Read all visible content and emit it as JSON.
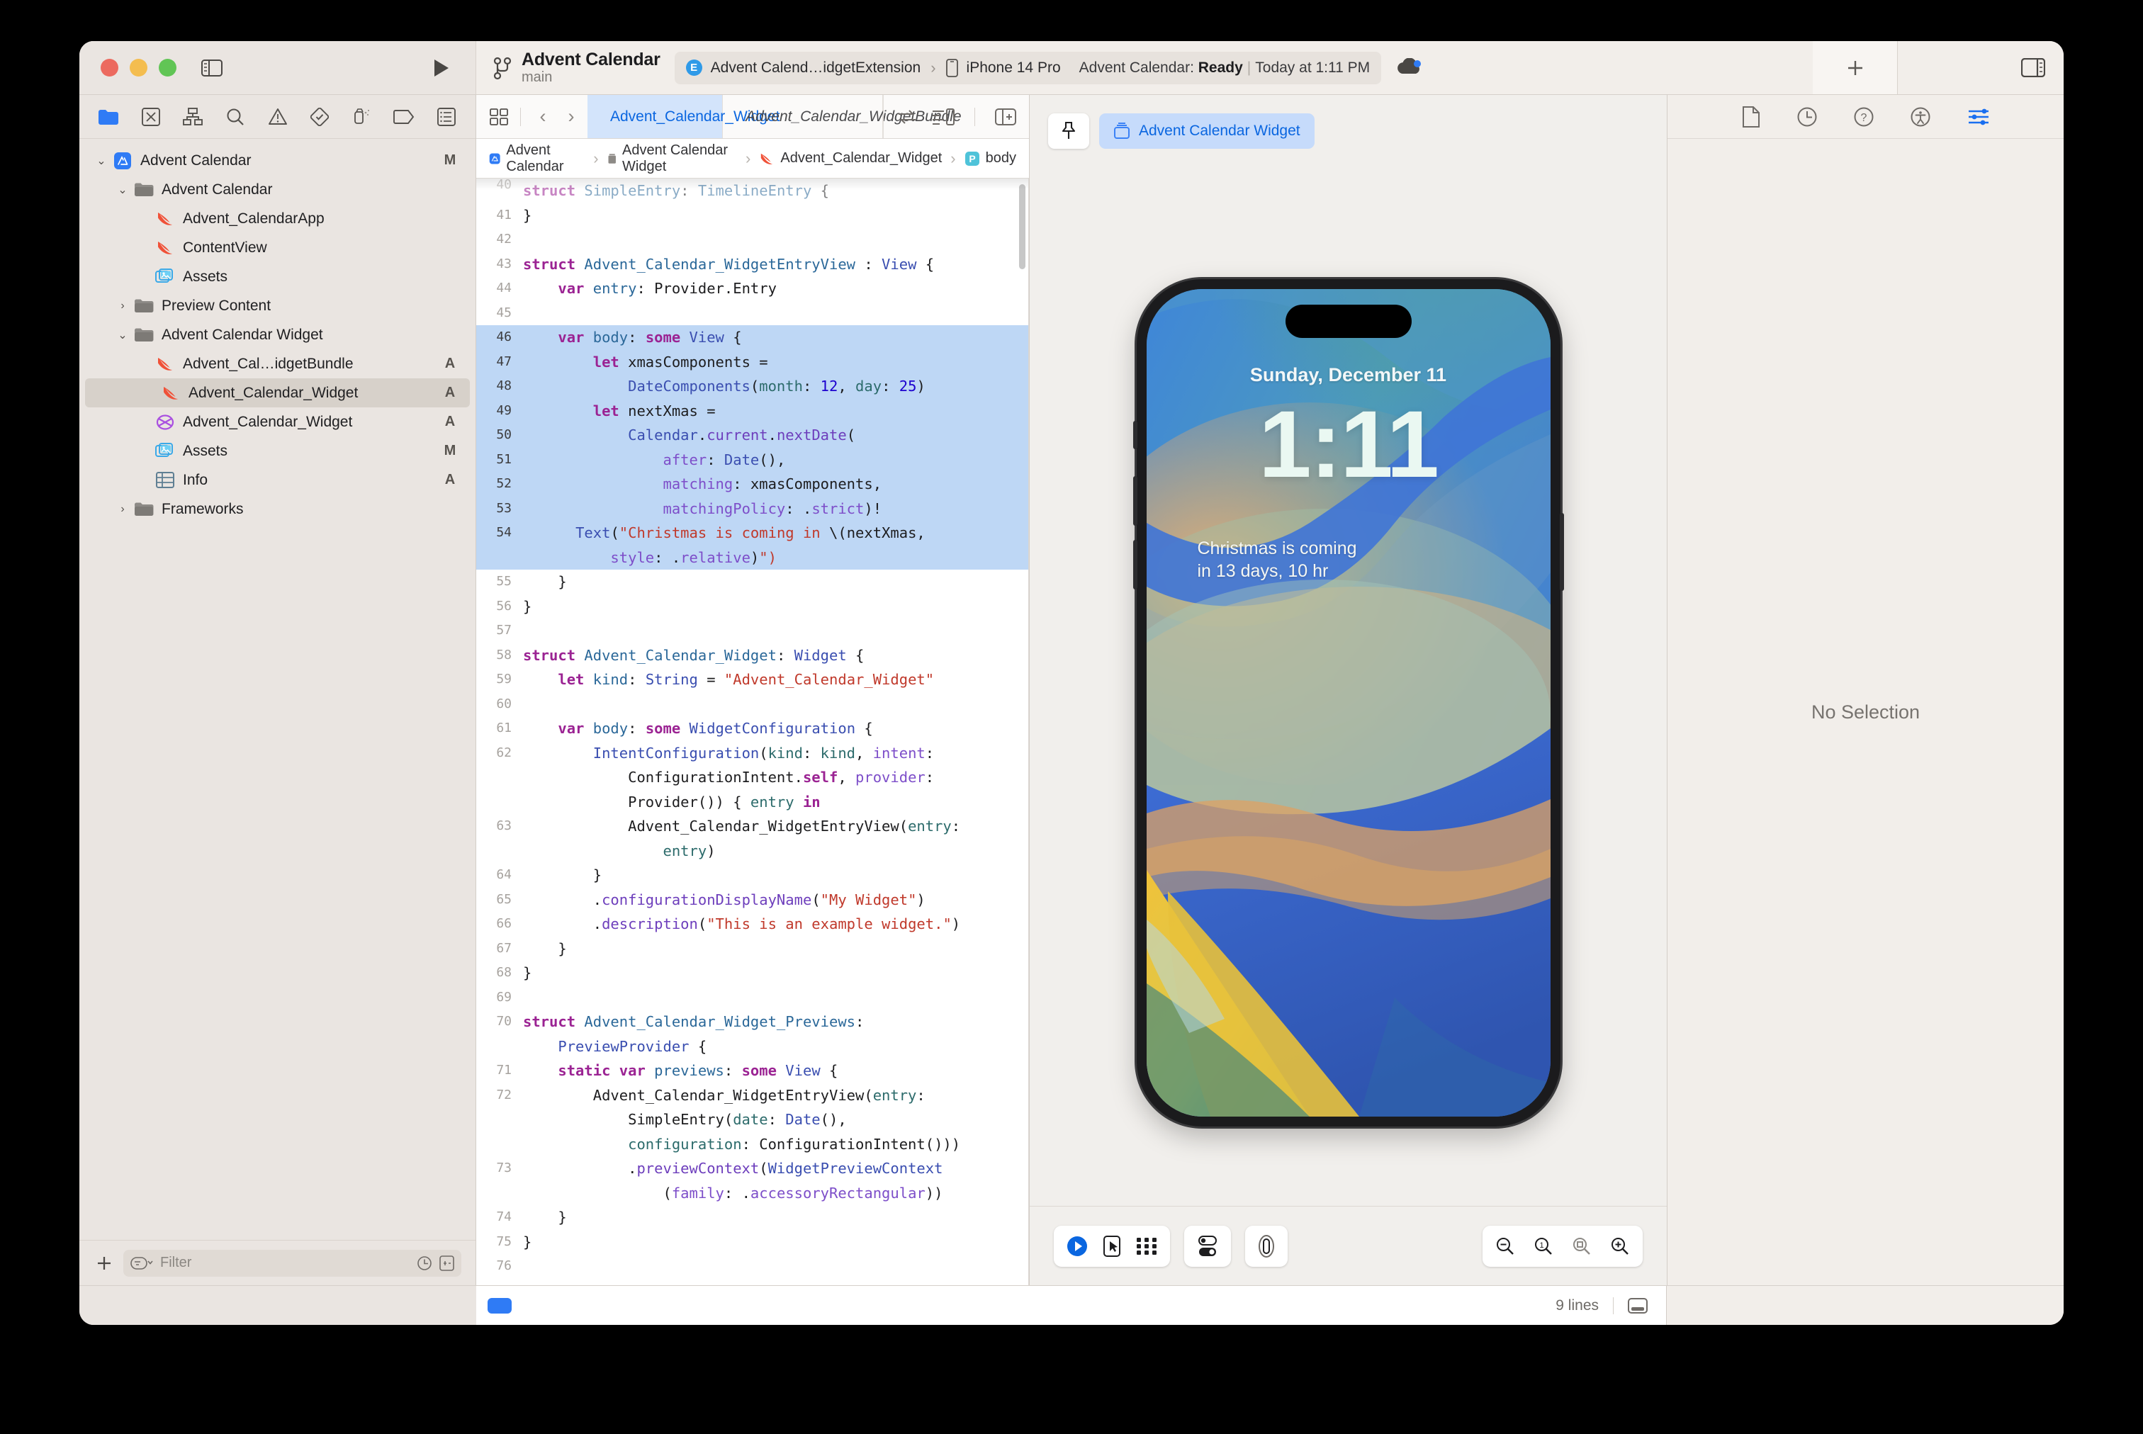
{
  "window": {
    "traffic_lights": [
      "close",
      "minimize",
      "zoom"
    ],
    "scheme": {
      "name": "Advent Calendar",
      "branch": "main",
      "target_badge": "E",
      "target": "Advent Calend…idgetExtension",
      "device": "iPhone 14 Pro",
      "status_prefix": "Advent Calendar:",
      "status_state": "Ready",
      "status_separator": "|",
      "status_time": "Today at 1:11 PM"
    }
  },
  "navigator": {
    "tabs": [
      "folder-icon",
      "source-control-icon",
      "symbol-icon",
      "find-icon",
      "issue-icon",
      "test-icon",
      "debug-icon",
      "breakpoint-icon",
      "report-icon"
    ],
    "tree": [
      {
        "label": "Advent Calendar",
        "icon": "app-icon",
        "indent": 0,
        "twisty": "down",
        "status": "M"
      },
      {
        "label": "Advent Calendar",
        "icon": "folder-icon",
        "indent": 1,
        "twisty": "down",
        "status": ""
      },
      {
        "label": "Advent_CalendarApp",
        "icon": "swift-icon",
        "indent": 2,
        "twisty": "",
        "status": ""
      },
      {
        "label": "ContentView",
        "icon": "swift-icon",
        "indent": 2,
        "twisty": "",
        "status": ""
      },
      {
        "label": "Assets",
        "icon": "assets-icon",
        "indent": 2,
        "twisty": "",
        "status": ""
      },
      {
        "label": "Preview Content",
        "icon": "folder-icon",
        "indent": 1,
        "twisty": "right",
        "status": ""
      },
      {
        "label": "Advent Calendar Widget",
        "icon": "folder-icon",
        "indent": 1,
        "twisty": "down",
        "status": ""
      },
      {
        "label": "Advent_Cal…idgetBundle",
        "icon": "swift-icon",
        "indent": 2,
        "twisty": "",
        "status": "A"
      },
      {
        "label": "Advent_Calendar_Widget",
        "icon": "swift-icon",
        "indent": 2,
        "twisty": "",
        "status": "A",
        "selected": true
      },
      {
        "label": "Advent_Calendar_Widget",
        "icon": "intent-icon",
        "indent": 2,
        "twisty": "",
        "status": "A"
      },
      {
        "label": "Assets",
        "icon": "assets-icon",
        "indent": 2,
        "twisty": "",
        "status": "M"
      },
      {
        "label": "Info",
        "icon": "plist-icon",
        "indent": 2,
        "twisty": "",
        "status": "A"
      },
      {
        "label": "Frameworks",
        "icon": "folder-icon",
        "indent": 1,
        "twisty": "right",
        "status": ""
      }
    ],
    "add_button": "+",
    "filter_placeholder": "Filter"
  },
  "editor": {
    "tabs": [
      {
        "label": "Advent_Calendar_Widget",
        "icon": "swift-icon",
        "active": true
      },
      {
        "label": "Advent_Calendar_WidgetBundle",
        "icon": "swift-icon",
        "active": false
      }
    ],
    "breadcrumb": [
      {
        "label": "Advent Calendar",
        "icon": "app-icon"
      },
      {
        "label": "Advent Calendar Widget",
        "icon": "folder-icon"
      },
      {
        "label": "Advent_Calendar_Widget",
        "icon": "swift-icon"
      },
      {
        "label": "body",
        "icon": "property-icon"
      }
    ],
    "lines": [
      {
        "n": "40",
        "partial": true,
        "tokens": [
          [
            "kw",
            "struct "
          ],
          [
            "typ",
            "SimpleEntry"
          ],
          [
            "pl",
            ": "
          ],
          [
            "typ",
            "TimelineEntry"
          ],
          [
            "pl",
            " {"
          ]
        ]
      },
      {
        "n": "41",
        "tokens": [
          [
            "pl",
            "}"
          ]
        ]
      },
      {
        "n": "42",
        "tokens": []
      },
      {
        "n": "43",
        "tokens": [
          [
            "kw",
            "struct "
          ],
          [
            "typ",
            "Advent_Calendar_WidgetEntryView"
          ],
          [
            "pl",
            " : "
          ],
          [
            "typ2",
            "View"
          ],
          [
            "pl",
            " {"
          ]
        ]
      },
      {
        "n": "44",
        "tokens": [
          [
            "pl",
            "    "
          ],
          [
            "kw",
            "var "
          ],
          [
            "typ",
            "entry"
          ],
          [
            "pl",
            ": Provider.Entry"
          ]
        ]
      },
      {
        "n": "45",
        "tokens": []
      },
      {
        "n": "46",
        "hl": true,
        "tokens": [
          [
            "pl",
            "    "
          ],
          [
            "kw",
            "var "
          ],
          [
            "typ",
            "body"
          ],
          [
            "pl",
            ": "
          ],
          [
            "kw",
            "some "
          ],
          [
            "typ2",
            "View"
          ],
          [
            "pl",
            " {"
          ]
        ]
      },
      {
        "n": "47",
        "hl": true,
        "tokens": [
          [
            "pl",
            "        "
          ],
          [
            "kw",
            "let "
          ],
          [
            "pl",
            "xmasComponents ="
          ]
        ]
      },
      {
        "n": "48",
        "hl": true,
        "tokens": [
          [
            "pl",
            "            "
          ],
          [
            "typ2",
            "DateComponents"
          ],
          [
            "pl",
            "("
          ],
          [
            "arg",
            "month"
          ],
          [
            "pl",
            ": "
          ],
          [
            "num",
            "12"
          ],
          [
            "pl",
            ", "
          ],
          [
            "arg",
            "day"
          ],
          [
            "pl",
            ": "
          ],
          [
            "num",
            "25"
          ],
          [
            "pl",
            ")"
          ]
        ]
      },
      {
        "n": "49",
        "hl": true,
        "tokens": [
          [
            "pl",
            "        "
          ],
          [
            "kw",
            "let "
          ],
          [
            "pl",
            "nextXmas ="
          ]
        ]
      },
      {
        "n": "50",
        "hl": true,
        "tokens": [
          [
            "pl",
            "            "
          ],
          [
            "typ2",
            "Calendar"
          ],
          [
            "pl",
            "."
          ],
          [
            "fn",
            "current"
          ],
          [
            "pl",
            "."
          ],
          [
            "fn",
            "nextDate"
          ],
          [
            "pl",
            "("
          ]
        ]
      },
      {
        "n": "51",
        "hl": true,
        "tokens": [
          [
            "pl",
            "                "
          ],
          [
            "prop",
            "after"
          ],
          [
            "pl",
            ": "
          ],
          [
            "typ2",
            "Date"
          ],
          [
            "pl",
            "(),"
          ]
        ]
      },
      {
        "n": "52",
        "hl": true,
        "tokens": [
          [
            "pl",
            "                "
          ],
          [
            "prop",
            "matching"
          ],
          [
            "pl",
            ": xmasComponents,"
          ]
        ]
      },
      {
        "n": "53",
        "hl": true,
        "tokens": [
          [
            "pl",
            "                "
          ],
          [
            "prop",
            "matchingPolicy"
          ],
          [
            "pl",
            ": ."
          ],
          [
            "prop",
            "strict"
          ],
          [
            "pl",
            ")!"
          ]
        ]
      },
      {
        "n": "54",
        "hl": true,
        "tokens": [
          [
            "pl",
            "      "
          ],
          [
            "typ2",
            "Text"
          ],
          [
            "pl",
            "("
          ],
          [
            "str",
            "\"Christmas is coming in "
          ],
          [
            "pl",
            "\\("
          ],
          [
            "pl",
            "nextXmas,"
          ]
        ]
      },
      {
        "n": "",
        "hl": true,
        "cont": true,
        "tokens": [
          [
            "pl",
            "          "
          ],
          [
            "prop",
            "style"
          ],
          [
            "pl",
            ": ."
          ],
          [
            "prop",
            "relative"
          ],
          [
            "pl",
            ")"
          ],
          [
            "str",
            "\")"
          ]
        ]
      },
      {
        "n": "55",
        "tokens": [
          [
            "pl",
            "    }"
          ]
        ]
      },
      {
        "n": "56",
        "tokens": [
          [
            "pl",
            "}"
          ]
        ]
      },
      {
        "n": "57",
        "tokens": []
      },
      {
        "n": "58",
        "tokens": [
          [
            "kw",
            "struct "
          ],
          [
            "typ",
            "Advent_Calendar_Widget"
          ],
          [
            "pl",
            ": "
          ],
          [
            "typ2",
            "Widget"
          ],
          [
            "pl",
            " {"
          ]
        ]
      },
      {
        "n": "59",
        "tokens": [
          [
            "pl",
            "    "
          ],
          [
            "kw",
            "let "
          ],
          [
            "typ",
            "kind"
          ],
          [
            "pl",
            ": "
          ],
          [
            "typ2",
            "String"
          ],
          [
            "pl",
            " = "
          ],
          [
            "str",
            "\"Advent_Calendar_Widget\""
          ]
        ]
      },
      {
        "n": "60",
        "tokens": []
      },
      {
        "n": "61",
        "tokens": [
          [
            "pl",
            "    "
          ],
          [
            "kw",
            "var "
          ],
          [
            "typ",
            "body"
          ],
          [
            "pl",
            ": "
          ],
          [
            "kw",
            "some "
          ],
          [
            "typ2",
            "WidgetConfiguration"
          ],
          [
            "pl",
            " {"
          ]
        ]
      },
      {
        "n": "62",
        "tokens": [
          [
            "pl",
            "        "
          ],
          [
            "typ2",
            "IntentConfiguration"
          ],
          [
            "pl",
            "("
          ],
          [
            "arg",
            "kind"
          ],
          [
            "pl",
            ": "
          ],
          [
            "arg",
            "kind"
          ],
          [
            "pl",
            ", "
          ],
          [
            "prop",
            "intent"
          ],
          [
            "pl",
            ":"
          ]
        ]
      },
      {
        "n": "",
        "cont": true,
        "tokens": [
          [
            "pl",
            "            ConfigurationIntent."
          ],
          [
            "kw",
            "self"
          ],
          [
            "pl",
            ", "
          ],
          [
            "prop",
            "provider"
          ],
          [
            "pl",
            ":"
          ]
        ]
      },
      {
        "n": "",
        "cont": true,
        "tokens": [
          [
            "pl",
            "            Provider()) { "
          ],
          [
            "arg",
            "entry"
          ],
          [
            "pl",
            " "
          ],
          [
            "kw",
            "in"
          ]
        ]
      },
      {
        "n": "63",
        "tokens": [
          [
            "pl",
            "            Advent_Calendar_WidgetEntryView("
          ],
          [
            "arg",
            "entry"
          ],
          [
            "pl",
            ":"
          ]
        ]
      },
      {
        "n": "",
        "cont": true,
        "tokens": [
          [
            "pl",
            "                "
          ],
          [
            "arg",
            "entry"
          ],
          [
            "pl",
            ")"
          ]
        ]
      },
      {
        "n": "64",
        "tokens": [
          [
            "pl",
            "        }"
          ]
        ]
      },
      {
        "n": "65",
        "tokens": [
          [
            "pl",
            "        ."
          ],
          [
            "fn",
            "configurationDisplayName"
          ],
          [
            "pl",
            "("
          ],
          [
            "str",
            "\"My Widget\""
          ],
          [
            "pl",
            ")"
          ]
        ]
      },
      {
        "n": "66",
        "tokens": [
          [
            "pl",
            "        ."
          ],
          [
            "fn",
            "description"
          ],
          [
            "pl",
            "("
          ],
          [
            "str",
            "\"This is an example widget.\""
          ],
          [
            "pl",
            ")"
          ]
        ]
      },
      {
        "n": "67",
        "tokens": [
          [
            "pl",
            "    }"
          ]
        ]
      },
      {
        "n": "68",
        "tokens": [
          [
            "pl",
            "}"
          ]
        ]
      },
      {
        "n": "69",
        "tokens": []
      },
      {
        "n": "70",
        "tokens": [
          [
            "kw",
            "struct "
          ],
          [
            "typ",
            "Advent_Calendar_Widget_Previews"
          ],
          [
            "pl",
            ":"
          ]
        ]
      },
      {
        "n": "",
        "cont": true,
        "tokens": [
          [
            "pl",
            "    "
          ],
          [
            "typ2",
            "PreviewProvider"
          ],
          [
            "pl",
            " {"
          ]
        ]
      },
      {
        "n": "71",
        "tokens": [
          [
            "pl",
            "    "
          ],
          [
            "kw",
            "static var "
          ],
          [
            "typ",
            "previews"
          ],
          [
            "pl",
            ": "
          ],
          [
            "kw",
            "some "
          ],
          [
            "typ2",
            "View"
          ],
          [
            "pl",
            " {"
          ]
        ]
      },
      {
        "n": "72",
        "tokens": [
          [
            "pl",
            "        Advent_Calendar_WidgetEntryView("
          ],
          [
            "arg",
            "entry"
          ],
          [
            "pl",
            ":"
          ]
        ]
      },
      {
        "n": "",
        "cont": true,
        "tokens": [
          [
            "pl",
            "            SimpleEntry("
          ],
          [
            "arg",
            "date"
          ],
          [
            "pl",
            ": "
          ],
          [
            "typ2",
            "Date"
          ],
          [
            "pl",
            "(),"
          ]
        ]
      },
      {
        "n": "",
        "cont": true,
        "tokens": [
          [
            "pl",
            "            "
          ],
          [
            "arg",
            "configuration"
          ],
          [
            "pl",
            ": ConfigurationIntent()))"
          ]
        ]
      },
      {
        "n": "73",
        "tokens": [
          [
            "pl",
            "            ."
          ],
          [
            "fn",
            "previewContext"
          ],
          [
            "pl",
            "("
          ],
          [
            "typ2",
            "WidgetPreviewContext"
          ]
        ]
      },
      {
        "n": "",
        "cont": true,
        "tokens": [
          [
            "pl",
            "                ("
          ],
          [
            "prop",
            "family"
          ],
          [
            "pl",
            ": ."
          ],
          [
            "prop",
            "accessoryRectangular"
          ],
          [
            "pl",
            "))"
          ]
        ]
      },
      {
        "n": "74",
        "tokens": [
          [
            "pl",
            "    }"
          ]
        ]
      },
      {
        "n": "75",
        "tokens": [
          [
            "pl",
            "}"
          ]
        ]
      },
      {
        "n": "76",
        "tokens": []
      }
    ],
    "status_lines": "9 lines"
  },
  "canvas": {
    "preview_chip": "Advent Calendar Widget",
    "device_preview": {
      "date": "Sunday, December 11",
      "time": "1:11",
      "widget_line1": "Christmas is coming",
      "widget_line2": "in 13 days, 10 hr"
    },
    "controls": {
      "play": "play-icon",
      "select": "selectable-icon",
      "variants": "variants-icon",
      "appearance": "appearance-toggle-icon",
      "device_settings": "device-bezel-icon",
      "zoom_out": "zoom-out-icon",
      "zoom_100": "zoom-100-icon",
      "zoom_fit": "zoom-fit-icon",
      "zoom_in": "zoom-in-icon"
    }
  },
  "inspector": {
    "tabs": [
      "file-inspector-icon",
      "history-inspector-icon",
      "quick-help-icon",
      "accessibility-icon",
      "attributes-inspector-icon"
    ],
    "active_tab_index": 4,
    "empty_message": "No Selection"
  },
  "colors": {
    "accent_blue": "#0a66e0",
    "selection_blue": "#bed7f5",
    "chrome_bg": "#eae5e1",
    "editor_bg": "#ffffff"
  }
}
